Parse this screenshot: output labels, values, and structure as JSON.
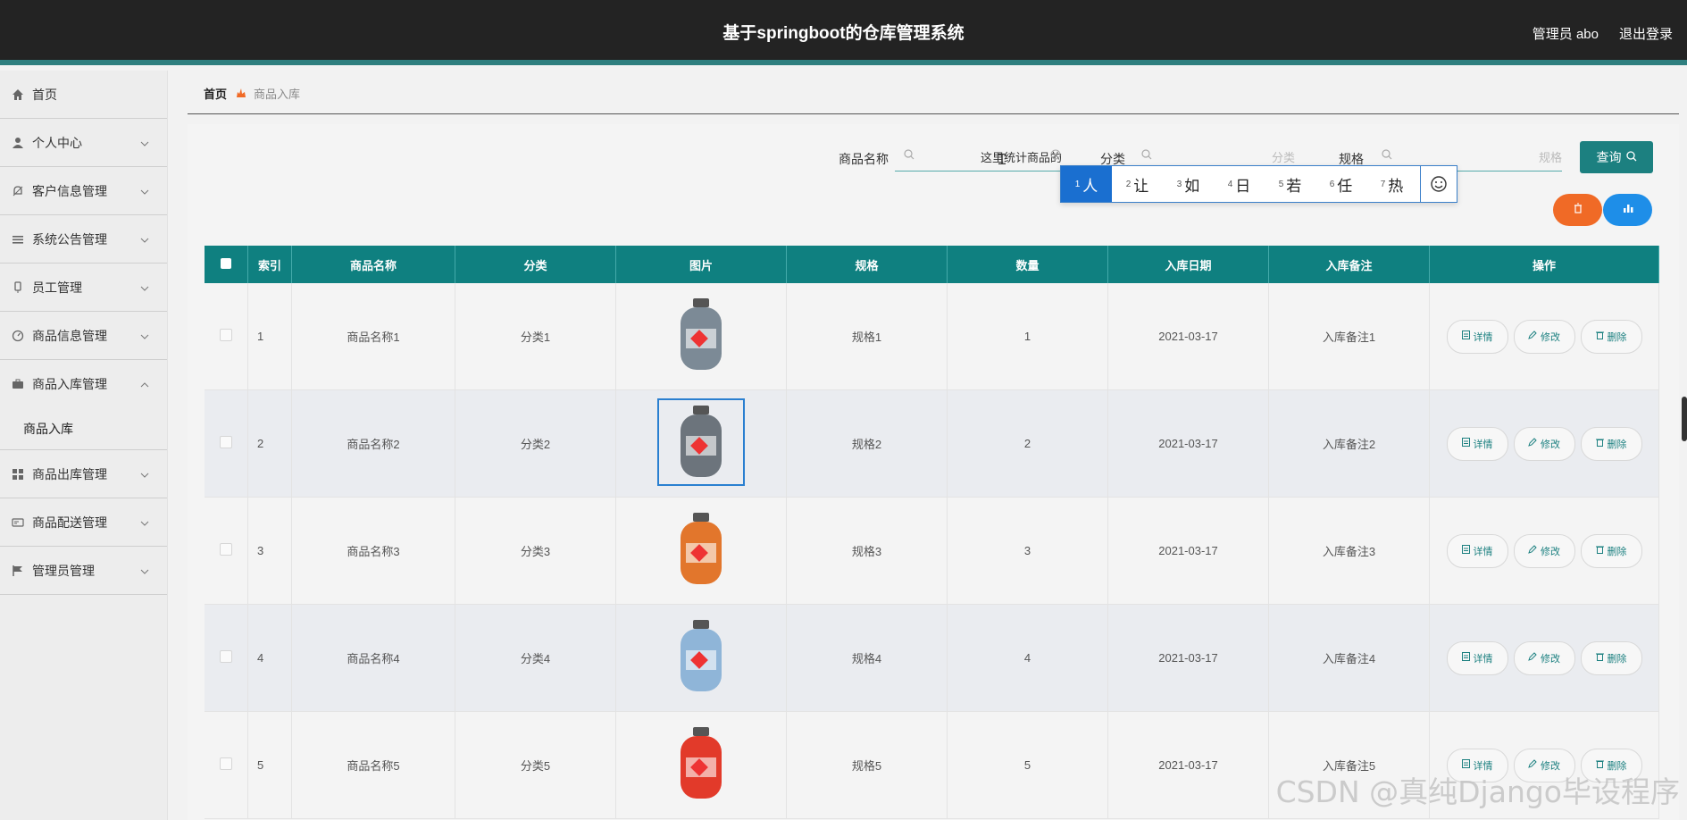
{
  "app": {
    "title": "基于springboot的仓库管理系统",
    "user": "管理员 abo",
    "logout": "退出登录"
  },
  "sidebar": {
    "items": [
      {
        "label": "首页",
        "icon": "home-icon"
      },
      {
        "label": "个人中心",
        "icon": "user-icon"
      },
      {
        "label": "客户信息管理",
        "icon": "bell-icon"
      },
      {
        "label": "系统公告管理",
        "icon": "list-icon"
      },
      {
        "label": "员工管理",
        "icon": "badge-icon"
      },
      {
        "label": "商品信息管理",
        "icon": "gauge-icon"
      },
      {
        "label": "商品入库管理",
        "icon": "briefcase-icon"
      },
      {
        "label": "商品出库管理",
        "icon": "grid-icon"
      },
      {
        "label": "商品配送管理",
        "icon": "card-icon"
      },
      {
        "label": "管理员管理",
        "icon": "flag-icon"
      }
    ],
    "sub_item": "商品入库"
  },
  "breadcrumb": {
    "home": "首页",
    "current": "商品入库"
  },
  "search": {
    "name_label": "商品名称",
    "name_value": "这里统计商品的",
    "category_label": "分类",
    "category_placeholder": "分类",
    "spec_label": "规格",
    "spec_placeholder": "规格",
    "query_button": "查询"
  },
  "ime": {
    "candidates": [
      {
        "n": "1",
        "c": "人"
      },
      {
        "n": "2",
        "c": "让"
      },
      {
        "n": "3",
        "c": "如"
      },
      {
        "n": "4",
        "c": "日"
      },
      {
        "n": "5",
        "c": "若"
      },
      {
        "n": "6",
        "c": "任"
      },
      {
        "n": "7",
        "c": "热"
      }
    ]
  },
  "table": {
    "headers": [
      "索引",
      "商品名称",
      "分类",
      "图片",
      "规格",
      "数量",
      "入库日期",
      "入库备注",
      "操作"
    ],
    "rows": [
      {
        "index": "1",
        "name": "商品名称1",
        "category": "分类1",
        "spec": "规格1",
        "qty": "1",
        "date": "2021-03-17",
        "remark": "入库备注1",
        "color": "#7c8a96"
      },
      {
        "index": "2",
        "name": "商品名称2",
        "category": "分类2",
        "spec": "规格2",
        "qty": "2",
        "date": "2021-03-17",
        "remark": "入库备注2",
        "color": "#6c747c"
      },
      {
        "index": "3",
        "name": "商品名称3",
        "category": "分类3",
        "spec": "规格3",
        "qty": "3",
        "date": "2021-03-17",
        "remark": "入库备注3",
        "color": "#e2762c"
      },
      {
        "index": "4",
        "name": "商品名称4",
        "category": "分类4",
        "spec": "规格4",
        "qty": "4",
        "date": "2021-03-17",
        "remark": "入库备注4",
        "color": "#8fb5d8"
      },
      {
        "index": "5",
        "name": "商品名称5",
        "category": "分类5",
        "spec": "规格5",
        "qty": "5",
        "date": "2021-03-17",
        "remark": "入库备注5",
        "color": "#e23a2a"
      }
    ],
    "ops": {
      "detail": "详情",
      "edit": "修改",
      "delete": "删除"
    }
  },
  "colors": {
    "teal": "#0f8080",
    "orange": "#f06a26",
    "blue": "#1e8ee8"
  },
  "watermark": "CSDN @真纯Django毕设程序"
}
